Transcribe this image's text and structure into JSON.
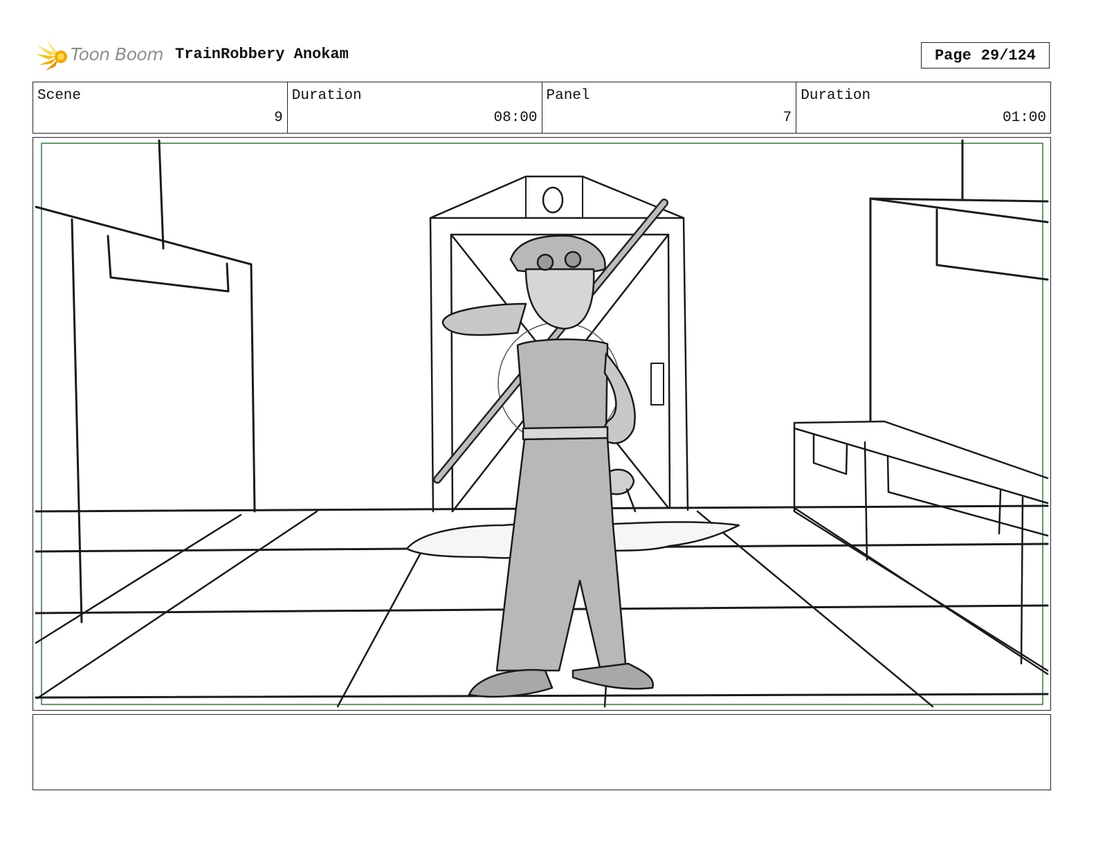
{
  "header": {
    "logo_text": "Toon Boom",
    "project_title": "TrainRobbery Anokam",
    "page_label": "Page",
    "page_number": "29/124"
  },
  "info": {
    "scene_label": "Scene",
    "scene_value": "9",
    "scene_duration_label": "Duration",
    "scene_duration_value": "08:00",
    "panel_label": "Panel",
    "panel_value": "7",
    "panel_duration_label": "Duration",
    "panel_duration_value": "01:00"
  },
  "notes": {
    "text": ""
  },
  "colors": {
    "safe_frame": "#2e7d32",
    "figure_fill": "#b8b8b8",
    "logo_orange": "#f2a900",
    "logo_yellow": "#ffd84a"
  },
  "icons": [
    "toon-boom-logo-icon"
  ]
}
